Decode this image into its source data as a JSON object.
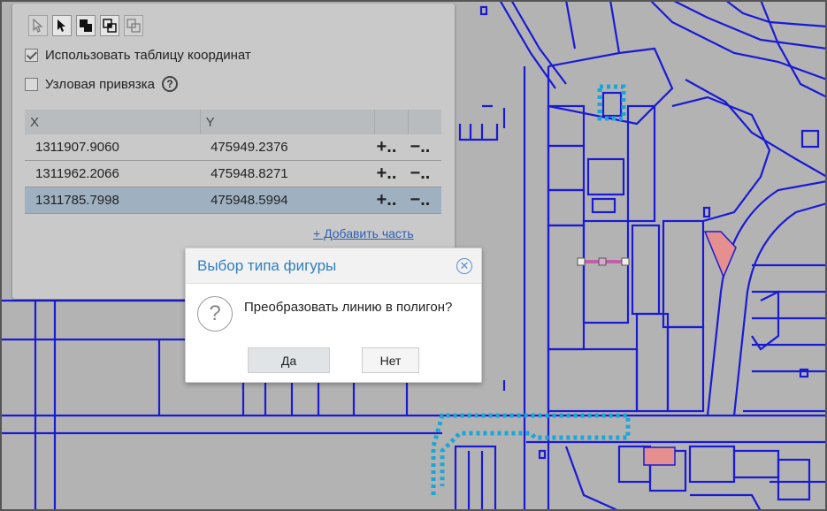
{
  "toolbar": {
    "tools": [
      {
        "icon": "select-arrow-outline-icon",
        "state": "disabled"
      },
      {
        "icon": "select-arrow-icon",
        "state": "enabled"
      },
      {
        "icon": "union-squares-icon",
        "state": "enabled"
      },
      {
        "icon": "intersect-squares-icon",
        "state": "enabled"
      },
      {
        "icon": "copy-squares-icon",
        "state": "disabled"
      }
    ]
  },
  "options": {
    "use_coord_table": {
      "label": "Использовать таблицу координат",
      "checked": true
    },
    "node_snap": {
      "label": "Узловая привязка",
      "checked": false
    }
  },
  "help_glyph": "?",
  "coords_table": {
    "headers": {
      "x": "X",
      "y": "Y"
    },
    "rows": [
      {
        "x": "1311907.9060",
        "y": "475949.2376",
        "add": "+..",
        "remove": "−.."
      },
      {
        "x": "1311962.2066",
        "y": "475948.8271",
        "add": "+..",
        "remove": "−.."
      },
      {
        "x": "1311785.7998",
        "y": "475948.5994",
        "add": "+..",
        "remove": "−..",
        "selected": true
      }
    ]
  },
  "add_part_label": "+ Добавить часть",
  "dialog": {
    "title": "Выбор типа фигуры",
    "close_glyph": "✕",
    "question_glyph": "?",
    "message": "Преобразовать линию в полигон?",
    "yes": "Да",
    "no": "Нет"
  },
  "colors": {
    "map_lines": "#1a1ad6",
    "dotted": "#19a7d8",
    "parcel_fill": "#e58f8f",
    "selection": "#9fb1c1",
    "accent": "#2f7fc1"
  }
}
